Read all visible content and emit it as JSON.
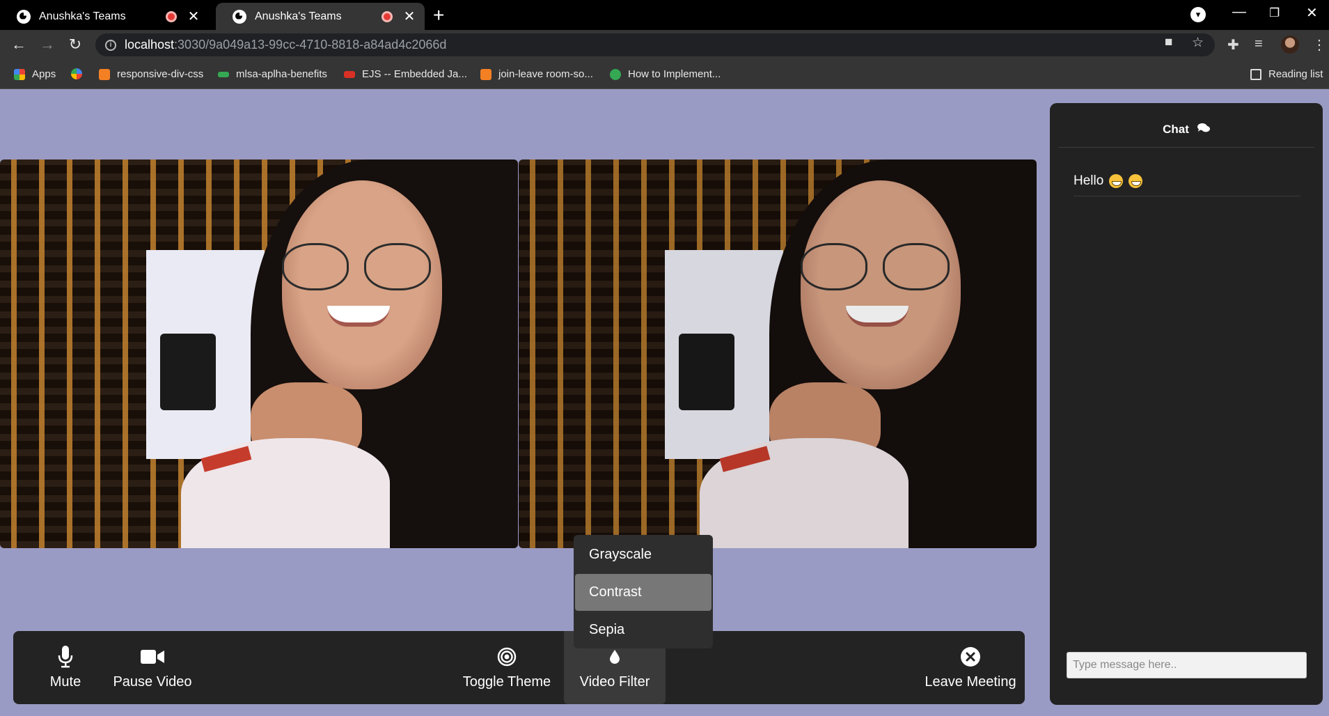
{
  "browser": {
    "tabs": [
      {
        "title": "Anushka's Teams"
      },
      {
        "title": "Anushka's Teams"
      }
    ],
    "address": {
      "host": "localhost",
      "path": ":3030/9a049a13-99cc-4710-8818-a84ad4c2066d"
    },
    "bookmarks": [
      {
        "label": "Apps",
        "color": "#ea4335"
      },
      {
        "label": "",
        "color": "#fbbc04"
      },
      {
        "label": "responsive-div-css",
        "color": "#f48024"
      },
      {
        "label": "mlsa-aplha-benefits",
        "color": "#34a853"
      },
      {
        "label": "EJS -- Embedded Ja...",
        "color": "#d93025"
      },
      {
        "label": "join-leave room-so...",
        "color": "#f48024"
      },
      {
        "label": "How to Implement...",
        "color": "#34a853"
      }
    ],
    "reading_list": "Reading list"
  },
  "chat": {
    "title": "Chat",
    "messages": [
      {
        "text": "Hello"
      }
    ],
    "input_placeholder": "Type message here.."
  },
  "controls": {
    "mute": "Mute",
    "pause_video": "Pause Video",
    "toggle_theme": "Toggle Theme",
    "video_filter": "Video Filter",
    "leave_meeting": "Leave Meeting"
  },
  "filter_menu": {
    "items": [
      "Grayscale",
      "Contrast",
      "Sepia"
    ],
    "selected": "Contrast"
  },
  "colors": {
    "page_bg": "#9a9bc4",
    "panel_bg": "#232323",
    "chat_bg": "#222222",
    "highlight": "#777777"
  }
}
